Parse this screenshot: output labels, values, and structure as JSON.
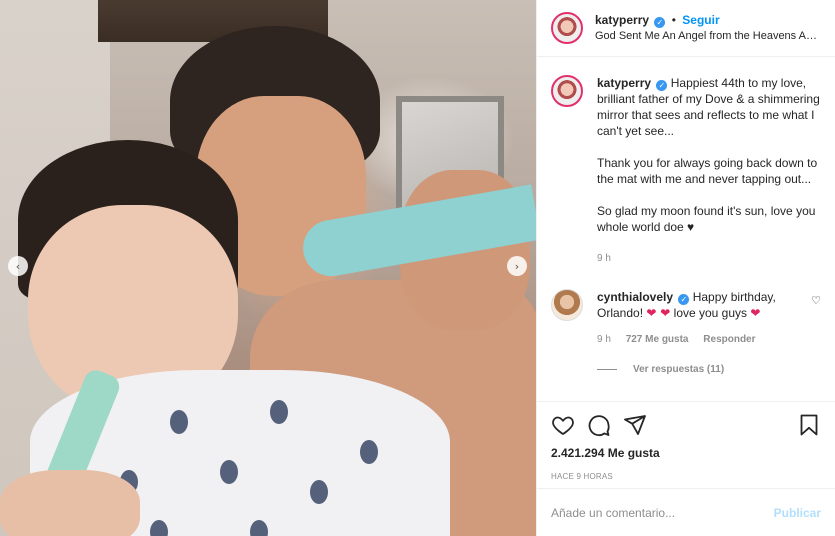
{
  "post": {
    "author": "katyperry",
    "follow_label": "Seguir",
    "separator": "•",
    "location": "God Sent Me An Angel from the Heavens Ab...",
    "verified_glyph": "✓",
    "nav_prev_glyph": "‹",
    "nav_next_glyph": "›"
  },
  "caption": {
    "author": "katyperry",
    "paragraph1": "Happiest 44th to my love, brilliant father of my Dove & a shimmering mirror that sees and reflects to me what I can't yet see...",
    "paragraph2": "Thank you for always going back down to the mat with me and never tapping out...",
    "paragraph3": "So glad my moon found it's sun, love you whole world doe ♥",
    "time": "9 h"
  },
  "reply": {
    "author": "cynthialovely",
    "text_before": "Happy birthday, Orlando!",
    "hearts": "❤ ❤",
    "text_after": "love you guys",
    "heart_end": "❤",
    "time": "9 h",
    "likes": "727 Me gusta",
    "reply_label": "Responder",
    "view_replies": "Ver respuestas (11)",
    "like_icon_glyph": "♡"
  },
  "actions": {
    "likes_count": "2.421.294 Me gusta",
    "time_ago": "HACE 9 HORAS"
  },
  "composer": {
    "placeholder": "Añade un comentario...",
    "publish_label": "Publicar"
  },
  "colors": {
    "accent": "#0095f6",
    "verified": "#3897f0",
    "heart_red": "#e0245e",
    "muted": "#8e8e8e"
  },
  "icons": [
    "heart-icon",
    "comment-icon",
    "share-icon",
    "bookmark-icon",
    "chevron-left-icon",
    "chevron-right-icon"
  ]
}
